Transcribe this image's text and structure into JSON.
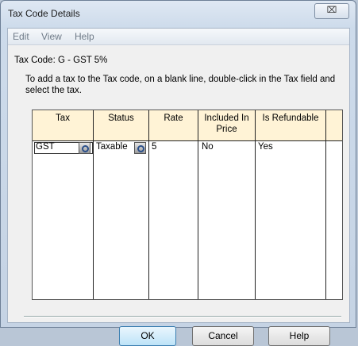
{
  "window": {
    "title": "Tax Code Details",
    "close_glyph": "⌧"
  },
  "menu": {
    "items": [
      "Edit",
      "View",
      "Help"
    ]
  },
  "tax_code": "Tax Code: G - GST 5%",
  "instructions": "To add a tax to the Tax code, on a blank line, double-click in the Tax field and select the tax.",
  "grid": {
    "columns": [
      "Tax",
      "Status",
      "Rate",
      "Included In Price",
      "Is Refundable"
    ],
    "rows": [
      {
        "tax": "GST",
        "status": "Taxable",
        "rate": "5",
        "included": "No",
        "refundable": "Yes"
      }
    ]
  },
  "buttons": {
    "ok": "OK",
    "cancel": "Cancel",
    "help": "Help"
  }
}
